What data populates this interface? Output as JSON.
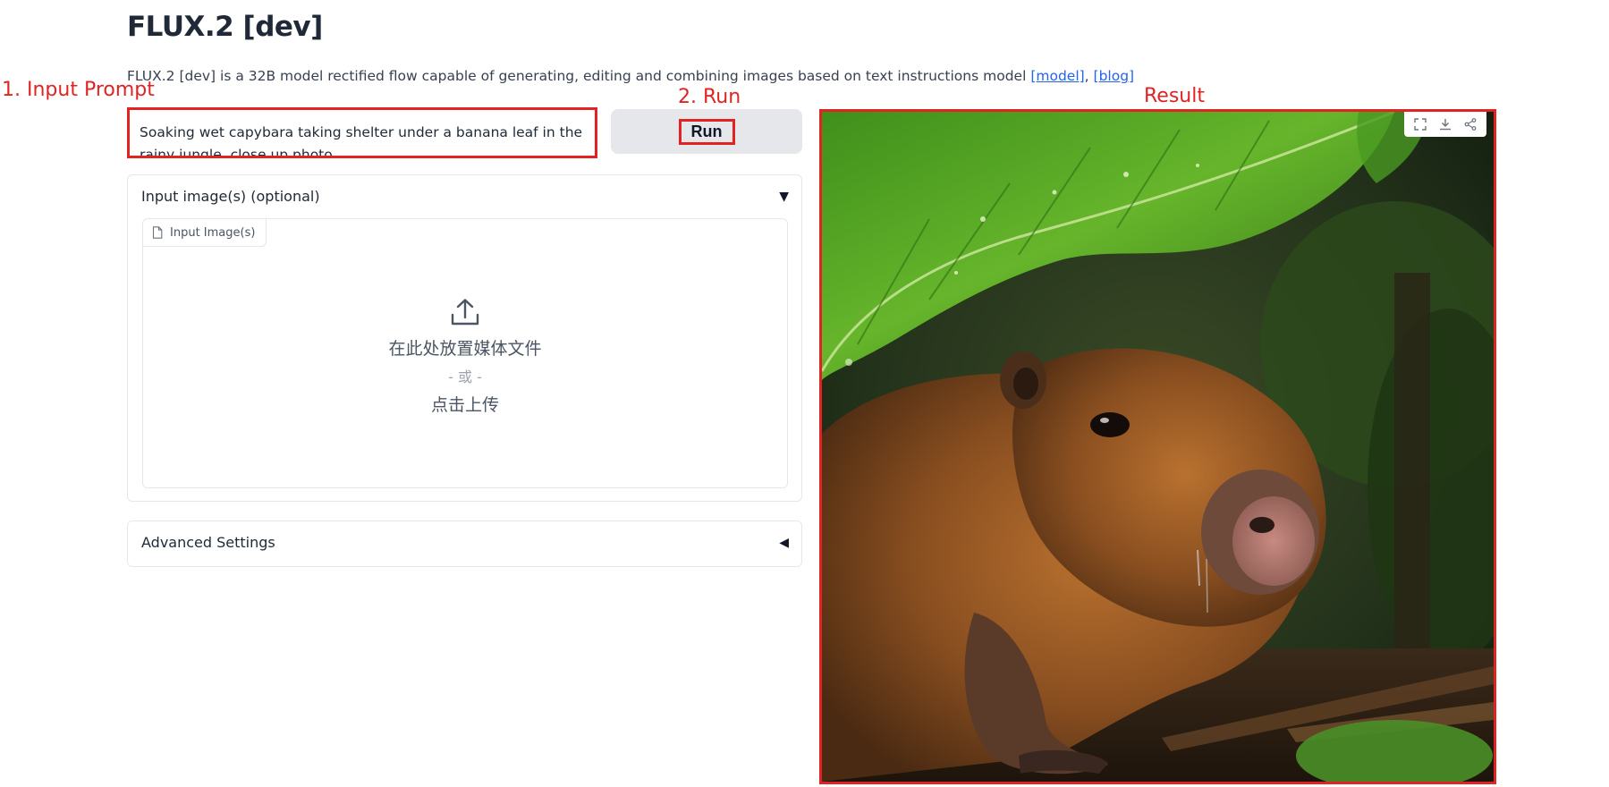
{
  "page": {
    "title": "FLUX.2 [dev]",
    "description_prefix": "FLUX.2 [dev] is a 32B model rectified flow capable of generating, editing and combining images based on text instructions model ",
    "model_link": "[model]",
    "separator": ", ",
    "blog_link": "[blog]"
  },
  "annotations": {
    "input_prompt": "1. Input Prompt",
    "run": "2. Run",
    "result": "Result"
  },
  "prompt": {
    "value": "Soaking wet capybara taking shelter under a banana leaf in the rainy jungle, close up photo"
  },
  "run_button": {
    "label": "Run"
  },
  "input_images": {
    "header": "Input image(s) (optional)",
    "caret": "▼",
    "tab_label": "Input Image(s)",
    "drop_text": "在此处放置媒体文件",
    "or_text": "- 或 -",
    "click_text": "点击上传"
  },
  "advanced": {
    "header": "Advanced Settings",
    "caret": "◀"
  },
  "result": {
    "toolbar_icons": [
      "fullscreen-icon",
      "download-icon",
      "share-icon"
    ]
  },
  "colors": {
    "annotation_red": "#e02424",
    "link_blue": "#2563eb",
    "button_gray": "#e5e7eb"
  }
}
